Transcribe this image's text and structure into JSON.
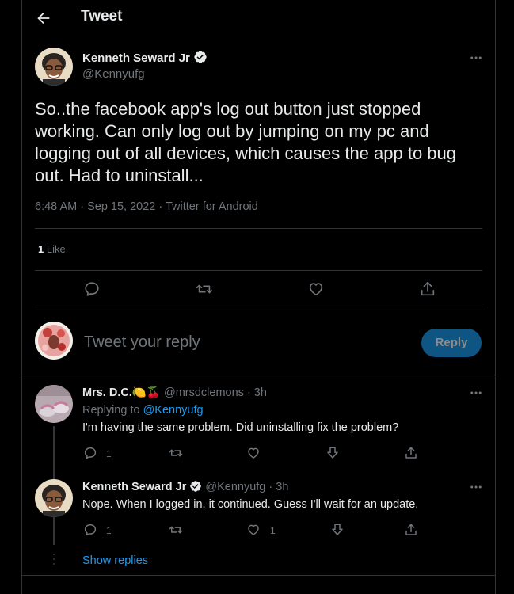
{
  "header": {
    "title": "Tweet"
  },
  "tweet": {
    "author_name": "Kenneth Seward Jr",
    "author_handle": "@Kennyufg",
    "text": "So..the facebook app's log out button just stopped working. Can only log out by jumping on my pc and logging out of all devices, which causes the app to bug out. Had to uninstall...",
    "timestamp": "6:48 AM · Sep 15, 2022 · Twitter for Android",
    "like_count": "1",
    "like_label": "Like"
  },
  "compose": {
    "placeholder": "Tweet your reply",
    "reply_label": "Reply"
  },
  "replies": [
    {
      "author_name": "Mrs. D.C.",
      "emoji": "🍋🍒",
      "handle_time": "@mrsdclemons · 3h",
      "replying_prefix": "Replying to ",
      "replying_to": "@Kennyufg",
      "text": "I'm having the same problem. Did uninstalling fix the problem?",
      "reply_count": "1",
      "like_count": ""
    },
    {
      "author_name": "Kenneth Seward Jr",
      "handle_time": "@Kennyufg · 3h",
      "text": "Nope. When I logged in, it continued. Guess I'll wait for an update.",
      "reply_count": "1",
      "like_count": "1"
    }
  ],
  "show_replies": "Show replies",
  "colors": {
    "accent": "#1d9bf0",
    "muted": "#71767b",
    "text": "#e7e9ea",
    "border": "#2f3336"
  },
  "icons": [
    "back-arrow-icon",
    "verified-badge-icon",
    "more-icon",
    "reply-icon",
    "retweet-icon",
    "like-icon",
    "share-icon",
    "downvote-icon"
  ]
}
